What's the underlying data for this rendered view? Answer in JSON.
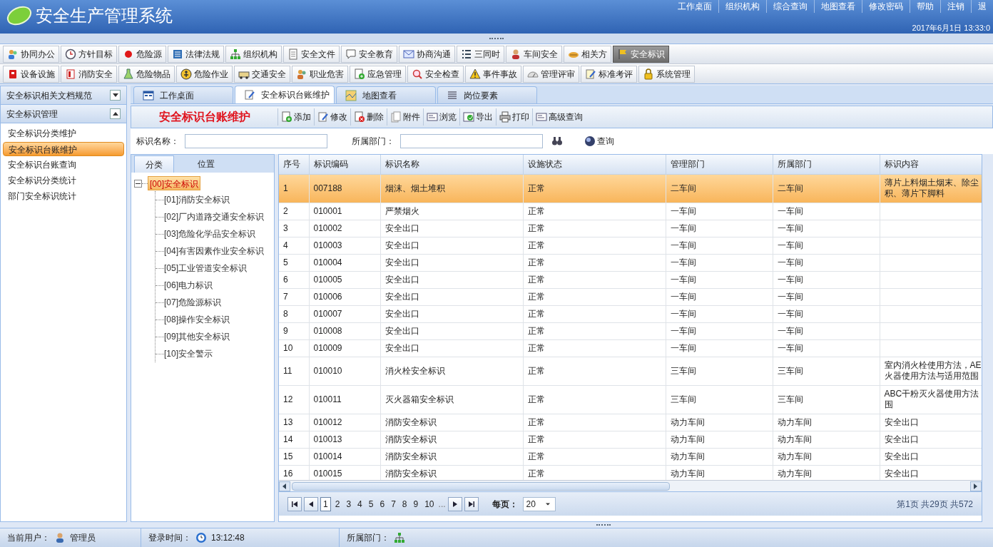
{
  "app": {
    "title": "安全生产管理系统",
    "links": [
      "工作桌面",
      "组织机构",
      "综合查询",
      "地图查看",
      "修改密码",
      "帮助",
      "注销",
      "退"
    ],
    "datetime": "2017年6月1日  13:33:0"
  },
  "modules_row1": [
    {
      "label": "协同办公",
      "selected": false
    },
    {
      "label": "方针目标",
      "selected": false
    },
    {
      "label": "危险源",
      "selected": false
    },
    {
      "label": "法律法规",
      "selected": false
    },
    {
      "label": "组织机构",
      "selected": false
    },
    {
      "label": "安全文件",
      "selected": false
    },
    {
      "label": "安全教育",
      "selected": false
    },
    {
      "label": "协商沟通",
      "selected": false
    },
    {
      "label": "三同时",
      "selected": false
    },
    {
      "label": "车间安全",
      "selected": false
    },
    {
      "label": "相关方",
      "selected": false
    },
    {
      "label": "安全标识",
      "selected": true
    }
  ],
  "modules_row2": [
    "设备设施",
    "消防安全",
    "危险物品",
    "危险作业",
    "交通安全",
    "职业危害",
    "应急管理",
    "安全检查",
    "事件事故",
    "管理评审",
    "标准考评",
    "系统管理"
  ],
  "sidebar": {
    "sections": [
      {
        "title": "安全标识相关文档规范",
        "expanded": false
      },
      {
        "title": "安全标识管理",
        "expanded": true,
        "items": [
          {
            "label": "安全标识分类维护",
            "selected": false
          },
          {
            "label": "安全标识台账维护",
            "selected": true
          },
          {
            "label": "安全标识台账查询",
            "selected": false
          },
          {
            "label": "安全标识分类统计",
            "selected": false
          },
          {
            "label": "部门安全标识统计",
            "selected": false
          }
        ]
      }
    ]
  },
  "tabs": [
    {
      "label": "工作桌面",
      "selected": false
    },
    {
      "label": "安全标识台账维护",
      "selected": true
    },
    {
      "label": "地图查看",
      "selected": false
    },
    {
      "label": "岗位要素",
      "selected": false
    }
  ],
  "page_title": "安全标识台账维护",
  "actions": [
    "添加",
    "修改",
    "删除",
    "附件",
    "浏览",
    "导出",
    "打印",
    "高级查询"
  ],
  "search": {
    "fields": [
      {
        "label": "标识名称："
      },
      {
        "label": "所属部门："
      }
    ],
    "button": "查询"
  },
  "tree_tabs": [
    {
      "label": "分类",
      "selected": true
    },
    {
      "label": "位置",
      "selected": false
    }
  ],
  "tree": {
    "label": "[00]安全标识",
    "selected": true,
    "expanded": true,
    "children": [
      {
        "label": "[01]消防安全标识"
      },
      {
        "label": "[02]厂内道路交通安全标识"
      },
      {
        "label": "[03]危险化学品安全标识"
      },
      {
        "label": "[04]有害因素作业安全标识"
      },
      {
        "label": "[05]工业管道安全标识"
      },
      {
        "label": "[06]电力标识"
      },
      {
        "label": "[07]危险源标识"
      },
      {
        "label": "[08]操作安全标识"
      },
      {
        "label": "[09]其他安全标识"
      },
      {
        "label": "[10]安全警示"
      }
    ]
  },
  "table": {
    "columns": [
      "序号",
      "标识编码",
      "标识名称",
      "设施状态",
      "管理部门",
      "所属部门",
      "标识内容"
    ],
    "rows": [
      {
        "cells": [
          "1",
          "007188",
          "烟沫、烟土堆积",
          "正常",
          "二车间",
          "二车间"
        ],
        "content": [
          "薄片上料烟土烟末、除尘",
          "积、薄片下脚料"
        ],
        "selected": true
      },
      {
        "cells": [
          "2",
          "010001",
          "严禁烟火",
          "正常",
          "一车间",
          "一车间"
        ],
        "selected": false
      },
      {
        "cells": [
          "3",
          "010002",
          "安全出口",
          "正常",
          "一车间",
          "一车间"
        ],
        "selected": false
      },
      {
        "cells": [
          "4",
          "010003",
          "安全出口",
          "正常",
          "一车间",
          "一车间"
        ],
        "selected": false
      },
      {
        "cells": [
          "5",
          "010004",
          "安全出口",
          "正常",
          "一车间",
          "一车间"
        ],
        "selected": false
      },
      {
        "cells": [
          "6",
          "010005",
          "安全出口",
          "正常",
          "一车间",
          "一车间"
        ],
        "selected": false
      },
      {
        "cells": [
          "7",
          "010006",
          "安全出口",
          "正常",
          "一车间",
          "一车间"
        ],
        "selected": false
      },
      {
        "cells": [
          "8",
          "010007",
          "安全出口",
          "正常",
          "一车间",
          "一车间"
        ],
        "selected": false
      },
      {
        "cells": [
          "9",
          "010008",
          "安全出口",
          "正常",
          "一车间",
          "一车间"
        ],
        "selected": false
      },
      {
        "cells": [
          "10",
          "010009",
          "安全出口",
          "正常",
          "一车间",
          "一车间"
        ],
        "selected": false
      },
      {
        "cells": [
          "11",
          "010010",
          "消火栓安全标识",
          "正常",
          "三车间",
          "三车间"
        ],
        "content": [
          "室内消火栓使用方法，AE",
          "火器使用方法与适用范围"
        ],
        "selected": false
      },
      {
        "cells": [
          "12",
          "010011",
          "灭火器箱安全标识",
          "正常",
          "三车间",
          "三车间"
        ],
        "content": [
          "ABC干粉灭火器使用方法",
          "围"
        ],
        "selected": false
      },
      {
        "cells": [
          "13",
          "010012",
          "消防安全标识",
          "正常",
          "动力车间",
          "动力车间"
        ],
        "content": [
          "安全出口"
        ],
        "selected": false
      },
      {
        "cells": [
          "14",
          "010013",
          "消防安全标识",
          "正常",
          "动力车间",
          "动力车间"
        ],
        "content": [
          "安全出口"
        ],
        "selected": false
      },
      {
        "cells": [
          "15",
          "010014",
          "消防安全标识",
          "正常",
          "动力车间",
          "动力车间"
        ],
        "content": [
          "安全出口"
        ],
        "selected": false
      },
      {
        "cells": [
          "16",
          "010015",
          "消防安全标识",
          "正常",
          "动力车间",
          "动力车间"
        ],
        "content": [
          "安全出口"
        ],
        "selected": false
      }
    ]
  },
  "pager": {
    "pages": [
      {
        "label": "1",
        "selected": true
      },
      {
        "label": "2",
        "selected": false
      },
      {
        "label": "3",
        "selected": false
      },
      {
        "label": "4",
        "selected": false
      },
      {
        "label": "5",
        "selected": false
      },
      {
        "label": "6",
        "selected": false
      },
      {
        "label": "7",
        "selected": false
      },
      {
        "label": "8",
        "selected": false
      },
      {
        "label": "9",
        "selected": false
      },
      {
        "label": "10",
        "selected": false
      }
    ],
    "ellipsis": "...",
    "per_page_label": "每页：",
    "per_page": "20",
    "summary": "第1页  共29页  共572"
  },
  "status_bar": [
    {
      "label": "当前用户：",
      "value": "管理员"
    },
    {
      "label": "登录时间：",
      "value": "13:12:48"
    },
    {
      "label": "所属部门："
    }
  ]
}
